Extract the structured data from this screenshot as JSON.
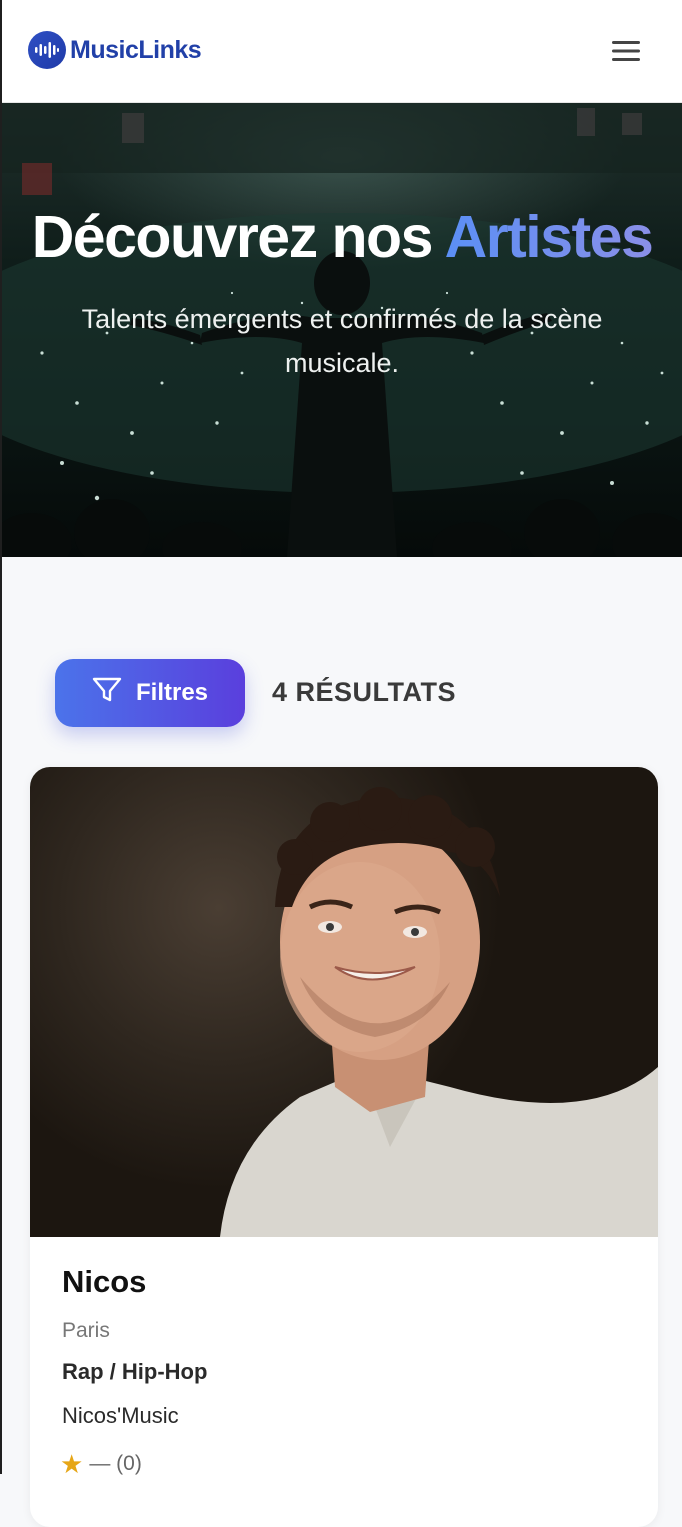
{
  "header": {
    "logo_text": "MusicLinks",
    "menu_icon": "hamburger-menu-icon",
    "logo_icon": "sound-wave-icon"
  },
  "hero": {
    "title_part1": "Découvrez nos ",
    "title_accent": "Artistes",
    "subtitle": "Talents émergents et confirmés de la scène musicale."
  },
  "toolbar": {
    "filters_label": "Filtres",
    "filters_icon": "filter-funnel-icon",
    "results_count": "4 RÉSULTATS"
  },
  "artists": [
    {
      "name": "Nicos",
      "city": "Paris",
      "genre": "Rap / Hip-Hop",
      "label": "Nicos'Music",
      "rating_text": "— (0)",
      "rating_icon": "star-icon"
    }
  ],
  "colors": {
    "brand": "#2140a8",
    "accent_gradient_start": "#4b73ea",
    "accent_gradient_end": "#5a3fdd",
    "star": "#e6a617"
  }
}
